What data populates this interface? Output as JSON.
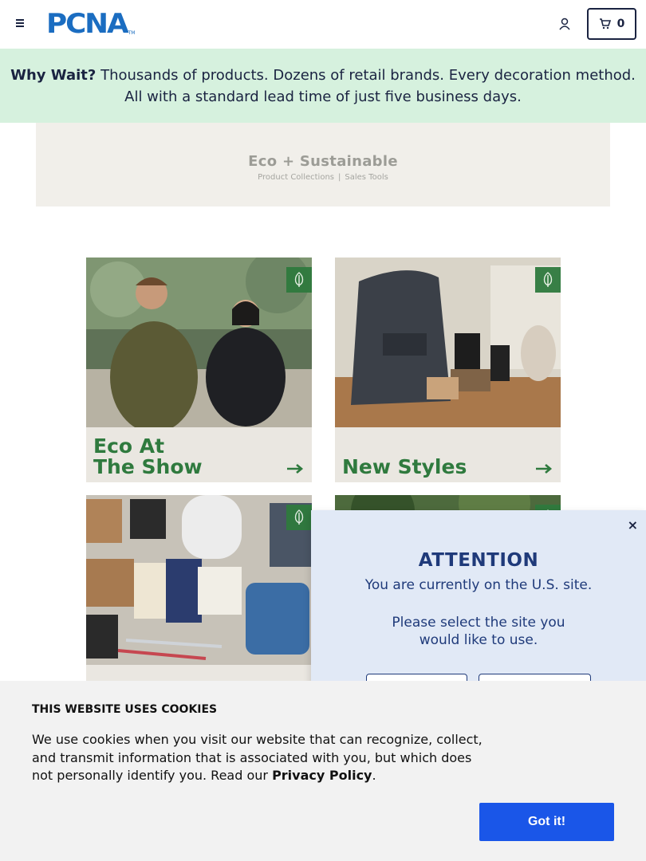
{
  "header": {
    "logo_text": "PCNA",
    "logo_tm": "TM",
    "cart_count": "0"
  },
  "promo": {
    "lead": "Why Wait?",
    "text": "Thousands of products. Dozens of retail brands. Every decoration method. All with a standard lead time of just five business days."
  },
  "eco_hero": {
    "title": "Eco + Sustainable",
    "link_1": "Product Collections",
    "separator": "|",
    "link_2": "Sales Tools"
  },
  "tiles": [
    {
      "label_line1": "Eco At",
      "label_line2": "The Show",
      "icon": "leaf-icon"
    },
    {
      "label_line1": "",
      "label_line2": "New Styles",
      "icon": "leaf-icon"
    },
    {
      "label_line1": "",
      "label_line2": "",
      "icon": "leaf-icon"
    },
    {
      "label_line1": "",
      "label_line2": "",
      "icon": "leaf-icon"
    }
  ],
  "attention": {
    "close": "×",
    "title": "ATTENTION",
    "line": "You are currently on the U.S. site.",
    "select": "Please select the site you would like to use."
  },
  "cookie": {
    "title": "THIS WEBSITE USES COOKIES",
    "text": "We use cookies when you visit our website that can recognize, collect, and transmit information that is associated with you, but which does not personally identify you. Read our",
    "link": "Privacy Policy",
    "period": ".",
    "button": "Got it!"
  },
  "colors": {
    "brand_blue": "#1b6dc1",
    "promo_bg": "#d6f1de",
    "eco_green": "#2f7a3e",
    "modal_bg": "#e1e9f6",
    "cookie_button": "#1a56e8"
  }
}
